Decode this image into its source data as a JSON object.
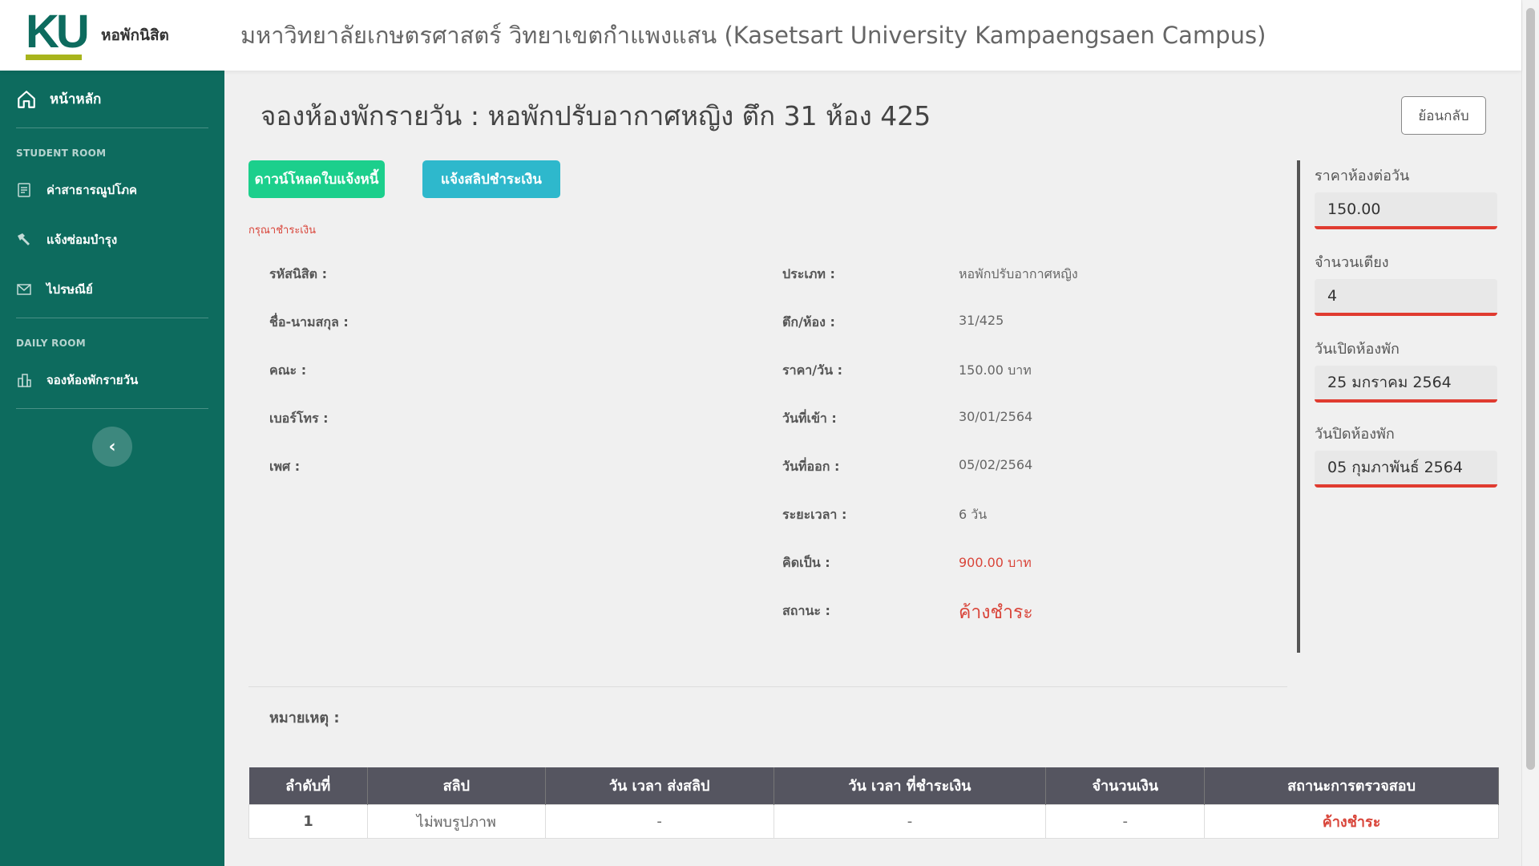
{
  "header": {
    "logo_text": "KU",
    "logo_caption": "หอพักนิสิต",
    "site_title": "มหาวิทยาลัยเกษตรศาสตร์ วิทยาเขตกำแพงแสน (Kasetsart University Kampaengsaen Campus)"
  },
  "sidebar": {
    "home_label": "หน้าหลัก",
    "section_student": "STUDENT ROOM",
    "items_student": [
      {
        "label": "ค่าสาธารณูปโภค",
        "icon": "document-icon"
      },
      {
        "label": "แจ้งซ่อมบำรุง",
        "icon": "hammer-icon"
      },
      {
        "label": "ไปรษณีย์",
        "icon": "mail-icon"
      }
    ],
    "section_daily": "DAILY ROOM",
    "items_daily": [
      {
        "label": "จองห้องพักรายวัน",
        "icon": "building-icon"
      }
    ],
    "collapse_icon": "chevron-left-icon"
  },
  "main": {
    "title": "จองห้องพักรายวัน :  หอพักปรับอากาศหญิง ตึก 31 ห้อง 425",
    "back_label": "ย้อนกลับ",
    "download_label": "ดาวน์โหลดใบแจ้งหนี้",
    "notify_label": "แจ้งสลิปชำระเงิน",
    "notice": "กรุณาชำระเงิน",
    "left_fields": [
      {
        "label": "รหัสนิสิต :",
        "value": ""
      },
      {
        "label": "ชื่อ-นามสกุล :",
        "value": ""
      },
      {
        "label": "คณะ :",
        "value": ""
      },
      {
        "label": "เบอร์โทร :",
        "value": ""
      },
      {
        "label": "เพศ :",
        "value": ""
      }
    ],
    "right_fields": [
      {
        "label": "ประเภท :",
        "value": "หอพักปรับอากาศหญิง"
      },
      {
        "label": "ตึก/ห้อง :",
        "value": "31/425"
      },
      {
        "label": "ราคา/วัน :",
        "value": "150.00 บาท"
      },
      {
        "label": "วันที่เข้า :",
        "value": "30/01/2564"
      },
      {
        "label": "วันที่ออก :",
        "value": "05/02/2564"
      },
      {
        "label": "ระยะเวลา :",
        "value": "6 วัน"
      },
      {
        "label": "คิดเป็น :",
        "value": "900.00 บาท"
      },
      {
        "label": "สถานะ :",
        "value": "ค้างชำระ"
      }
    ],
    "note_label": "หมายเหตุ :"
  },
  "panel": {
    "price_label": "ราคาห้องต่อวัน",
    "price_value": "150.00",
    "beds_label": "จำนวนเตียง",
    "beds_value": "4",
    "open_label": "วันเปิดห้องพัก",
    "open_value": "25 มกราคม 2564",
    "close_label": "วันปิดห้องพัก",
    "close_value": "05 กุมภาพันธ์ 2564",
    "accent_color": "#e03b30"
  },
  "table": {
    "headers": [
      "ลำดับที่",
      "สลิป",
      "วัน เวลา ส่งสลิป",
      "วัน เวลา ที่ชำระเงิน",
      "จำนวนเงิน",
      "สถานะการตรวจสอบ"
    ],
    "rows": [
      [
        "1",
        "ไม่พบรูปภาพ",
        "-",
        "-",
        "-",
        "ค้างชำระ"
      ]
    ]
  },
  "colors": {
    "sidebar": "#0d6b5e",
    "button_green": "#1ccf8c",
    "button_teal": "#2eb8cc",
    "alert_red": "#d9453a"
  }
}
